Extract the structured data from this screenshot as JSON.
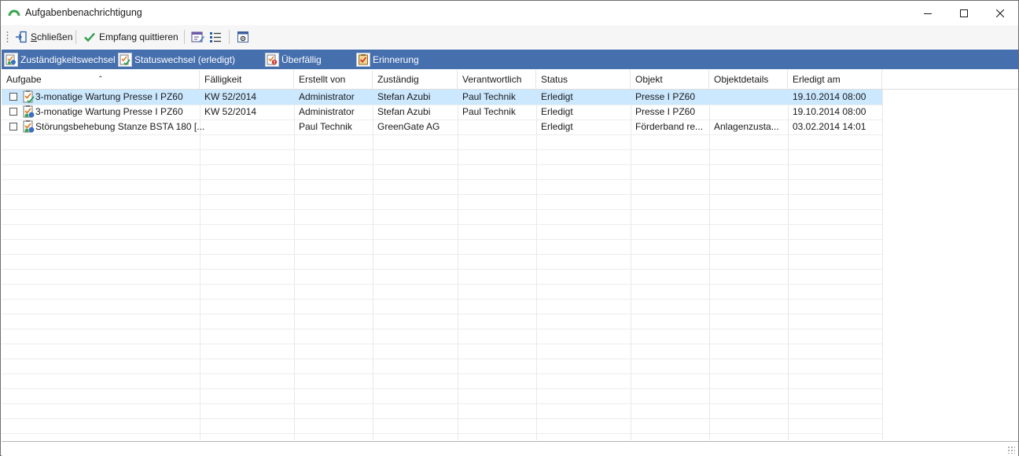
{
  "window": {
    "title": "Aufgabenbenachrichtigung",
    "icon": "arc-logo-icon",
    "controls": [
      "minimize-icon",
      "maximize-icon",
      "close-icon"
    ]
  },
  "toolbar": {
    "close_label_underlined": "S",
    "close_label_rest": "chließen",
    "acknowledge_label": "Empfang quittieren",
    "icons": [
      "exit-door-icon",
      "checkmark-icon",
      "edit-task-icon",
      "list-icon",
      "settings-window-icon"
    ]
  },
  "filters": [
    {
      "label": "Zuständigkeitswechsel",
      "icon": "responsibility-change-icon"
    },
    {
      "label": "Statuswechsel (erledigt)",
      "icon": "status-change-icon"
    },
    {
      "label": "Überfällig",
      "icon": "overdue-icon"
    },
    {
      "label": "Erinnerung",
      "icon": "reminder-icon"
    }
  ],
  "grid": {
    "columns": [
      "Aufgabe",
      "Fälligkeit",
      "Erstellt von",
      "Zuständig",
      "Verantwortlich",
      "Status",
      "Objekt",
      "Objektdetails",
      "Erledigt am"
    ],
    "rows": [
      {
        "aufgabe": "3-monatige Wartung Presse I PZ60",
        "faelligkeit": "KW 52/2014",
        "erstellt_von": "Administrator",
        "zustaendig": "Stefan Azubi",
        "verantwortlich": "Paul Technik",
        "status": "Erledigt",
        "objekt": "Presse I PZ60",
        "objektdetails": "",
        "erledigt_am": "19.10.2014 08:00",
        "icon": "status-change-icon",
        "selected": true
      },
      {
        "aufgabe": "3-monatige Wartung Presse I PZ60",
        "faelligkeit": "KW 52/2014",
        "erstellt_von": "Administrator",
        "zustaendig": "Stefan Azubi",
        "verantwortlich": "Paul Technik",
        "status": "Erledigt",
        "objekt": "Presse I PZ60",
        "objektdetails": "",
        "erledigt_am": "19.10.2014 08:00",
        "icon": "responsibility-change-icon",
        "selected": false
      },
      {
        "aufgabe": "Störungsbehebung Stanze BSTA 180 [...",
        "faelligkeit": "",
        "erstellt_von": "Paul Technik",
        "zustaendig": "GreenGate AG",
        "verantwortlich": "",
        "status": "Erledigt",
        "objekt": "Förderband re...",
        "objektdetails": "Anlagenzusta...",
        "erledigt_am": "03.02.2014 14:01",
        "icon": "responsibility-change-icon",
        "selected": false
      }
    ]
  },
  "colors": {
    "filter_band": "#466fae",
    "selected_row": "#cce8ff",
    "accent_green": "#2e9e4f"
  }
}
